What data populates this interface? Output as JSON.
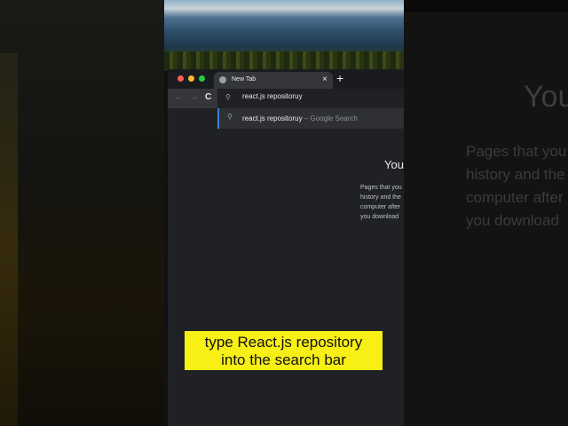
{
  "browser": {
    "tab_title": "New Tab",
    "close_tab": "×",
    "new_tab": "+",
    "omnibox_value": "react.js repositoruy",
    "suggestion_query": "react.js repositoruy",
    "suggestion_source": "– Google Search",
    "back": "←",
    "forward": "→",
    "reload": "C",
    "search_glyph": "⚲"
  },
  "content": {
    "heading": "You",
    "lines": [
      "Pages that you",
      "history and the",
      "computer after",
      "you download"
    ]
  },
  "caption": {
    "line1": "type React.js repository",
    "line2": "into the search bar"
  }
}
